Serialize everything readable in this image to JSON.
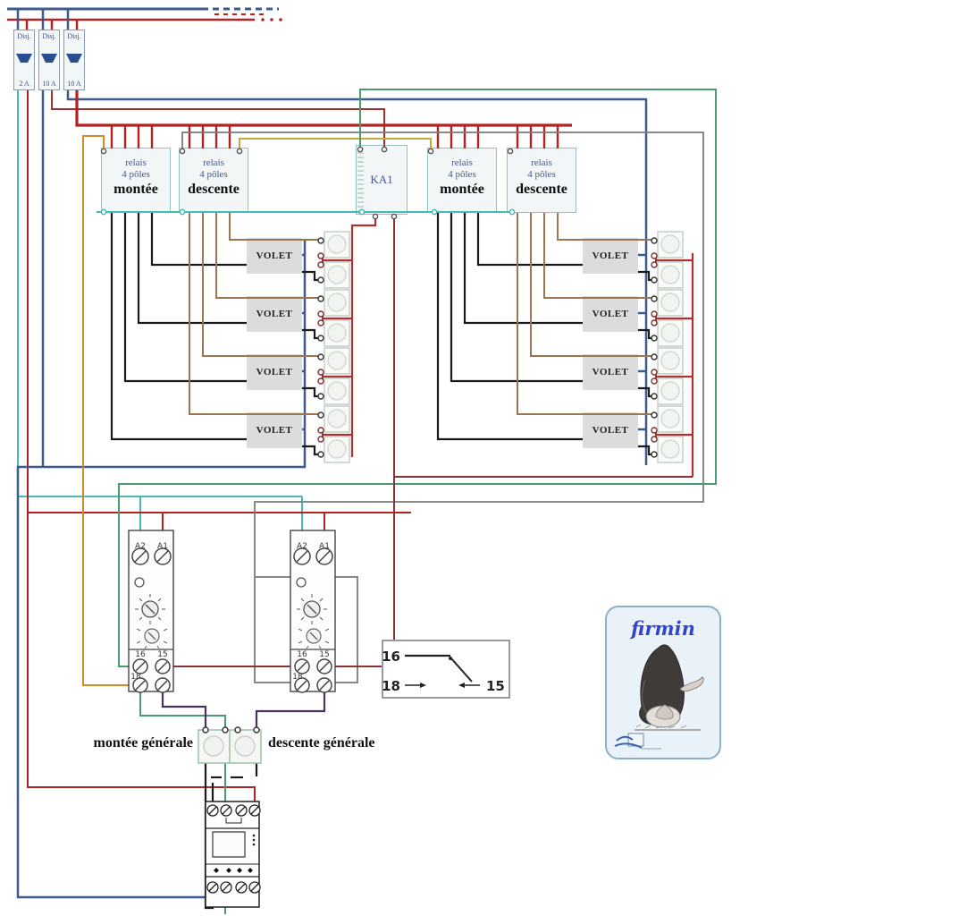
{
  "palette": {
    "phase_red": "#b22222",
    "dark_red": "#8b3232",
    "blue": "#3c5a8c",
    "teal": "#45b8b8",
    "green": "#4a9c6e",
    "orange": "#d4882a",
    "yellow": "#c8a83c",
    "gray": "#7a7a7a",
    "black": "#1a1a1a",
    "tan": "#9b7653",
    "purple": "#4a3258",
    "signature_blue": "#3344cc"
  },
  "breakers": {
    "items": [
      {
        "label": "Disj.",
        "rating": "2 A"
      },
      {
        "label": "Disj.",
        "rating": "10 A"
      },
      {
        "label": "Disj.",
        "rating": "10 A"
      }
    ]
  },
  "relays": {
    "items": [
      {
        "l1": "relais",
        "l2": "4 pôles",
        "l3": "montée"
      },
      {
        "l1": "relais",
        "l2": "4 pôles",
        "l3": "descente"
      },
      {
        "l1": "relais",
        "l2": "4 pôles",
        "l3": "montée"
      },
      {
        "l1": "relais",
        "l2": "4 pôles",
        "l3": "descente"
      }
    ],
    "ka1": {
      "label": "KA1"
    }
  },
  "volets": {
    "labels": [
      "VOLET",
      "VOLET",
      "VOLET",
      "VOLET",
      "VOLET",
      "VOLET",
      "VOLET",
      "VOLET"
    ]
  },
  "timers": {
    "labels": {
      "a2": "A2",
      "a1": "A1",
      "t16": "16",
      "t15": "15",
      "t18": "18"
    }
  },
  "legend": {
    "t16": "16",
    "t18": "18",
    "t15": "15"
  },
  "general": {
    "up": "montée générale",
    "down": "descente générale"
  },
  "signature": {
    "name": "firmin"
  }
}
